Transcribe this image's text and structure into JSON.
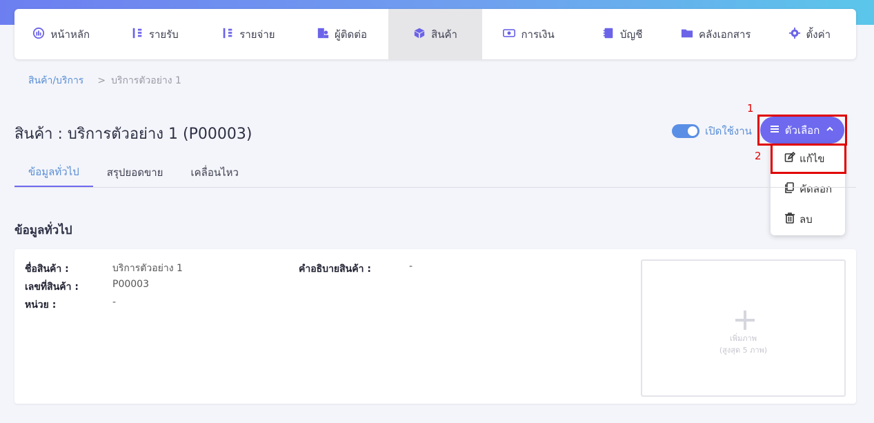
{
  "nav": {
    "items": [
      {
        "label": "หน้าหลัก",
        "icon": "dashboard-icon"
      },
      {
        "label": "รายรับ",
        "icon": "income-icon"
      },
      {
        "label": "รายจ่าย",
        "icon": "expense-icon"
      },
      {
        "label": "ผู้ติดต่อ",
        "icon": "contacts-icon"
      },
      {
        "label": "สินค้า",
        "icon": "box-icon",
        "active": true
      },
      {
        "label": "การเงิน",
        "icon": "money-icon"
      },
      {
        "label": "บัญชี",
        "icon": "book-icon"
      },
      {
        "label": "คลังเอกสาร",
        "icon": "folder-icon"
      },
      {
        "label": "ตั้งค่า",
        "icon": "gear-icon"
      }
    ]
  },
  "breadcrumb": {
    "link": "สินค้า/บริการ",
    "separator": ">",
    "current": "บริการตัวอย่าง 1"
  },
  "page": {
    "title": "สินค้า : บริการตัวอย่าง 1 (P00003)",
    "toggle_label": "เปิดใช้งาน",
    "toggle_on": true
  },
  "options": {
    "button_label": "ตัวเลือก",
    "items": [
      {
        "label": "แก้ไข",
        "icon": "edit-icon"
      },
      {
        "label": "คัดลอก",
        "icon": "copy-icon"
      },
      {
        "label": "ลบ",
        "icon": "trash-icon"
      }
    ]
  },
  "annotations": {
    "step1": "1",
    "step2": "2",
    "color": "#e00000"
  },
  "tabs": [
    {
      "label": "ข้อมูลทั่วไป",
      "active": true
    },
    {
      "label": "สรุปยอดขาย"
    },
    {
      "label": "เคลื่อนไหว"
    }
  ],
  "section": {
    "title": "ข้อมูลทั่วไป"
  },
  "details": {
    "name_label": "ชื่อสินค้า :",
    "name_value": "บริการตัวอย่าง 1",
    "code_label": "เลขที่สินค้า :",
    "code_value": "P00003",
    "unit_label": "หน่วย :",
    "unit_value": "-",
    "desc_label": "คำอธิบายสินค้า :",
    "desc_value": "-"
  },
  "image_upload": {
    "line1": "เพิ่มภาพ",
    "line2": "(สูงสุด 5 ภาพ)"
  },
  "colors": {
    "accent": "#6e69ef",
    "link": "#5a8fd6"
  }
}
